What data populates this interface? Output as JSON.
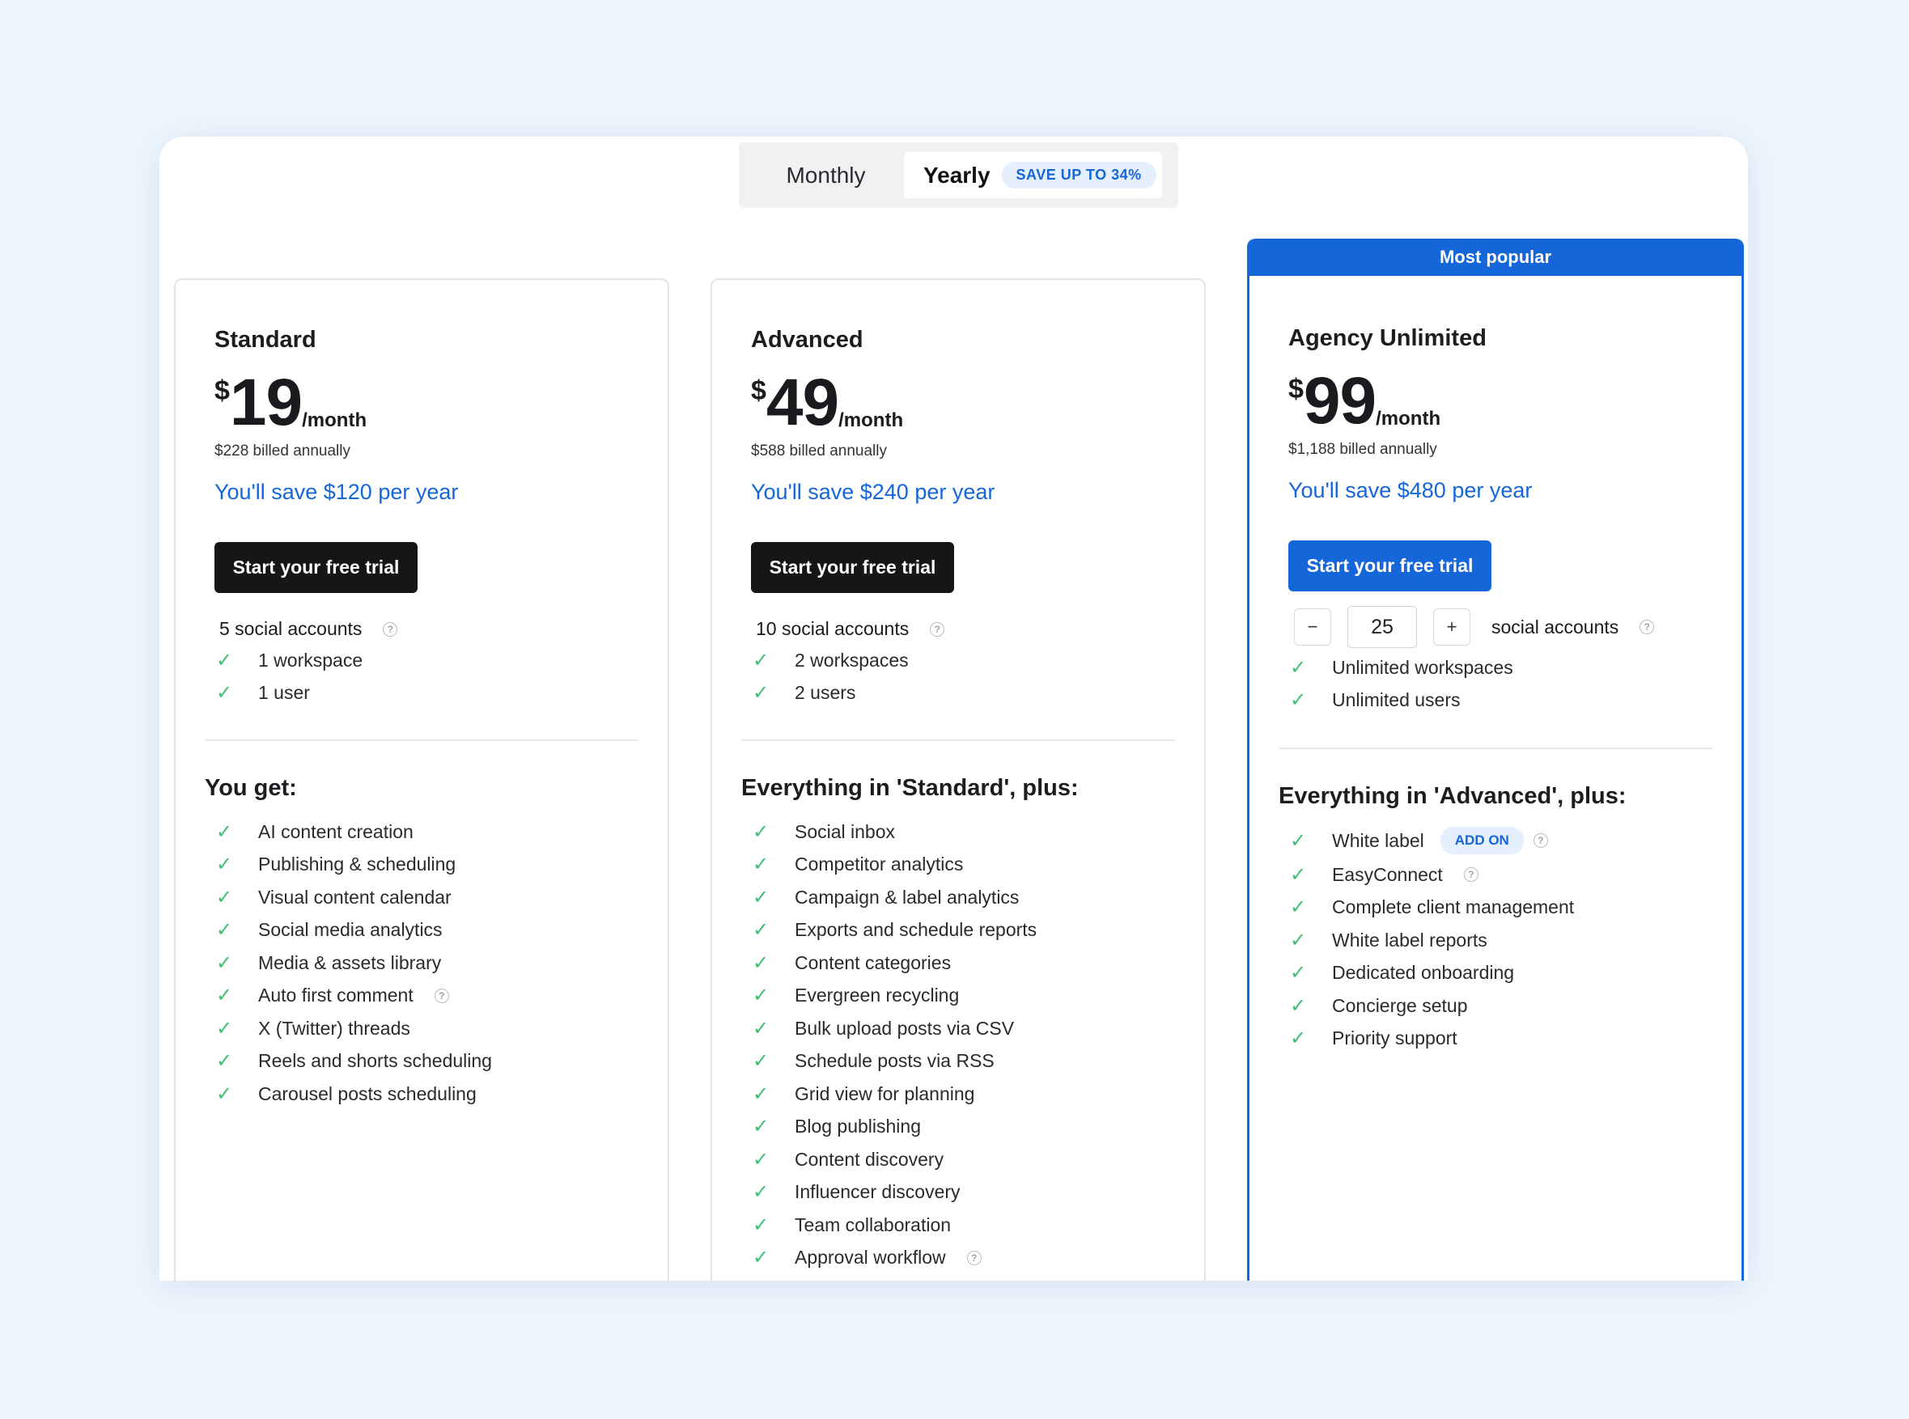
{
  "toggle": {
    "monthly": "Monthly",
    "yearly": "Yearly",
    "badge": "SAVE UP TO 34%"
  },
  "plans": [
    {
      "name": "Standard",
      "currency": "$",
      "price": "19",
      "per": "/month",
      "billed": "$228 billed annually",
      "save": "You'll save $120 per year",
      "cta": "Start your free trial",
      "accounts": "5 social accounts",
      "basics": [
        "1 workspace",
        "1 user"
      ],
      "heading": "You get:",
      "features": [
        "AI content creation",
        "Publishing & scheduling",
        "Visual content calendar",
        "Social media analytics",
        "Media & assets library",
        "Auto first comment",
        "X (Twitter) threads",
        "Reels and shorts scheduling",
        "Carousel posts scheduling"
      ]
    },
    {
      "name": "Advanced",
      "currency": "$",
      "price": "49",
      "per": "/month",
      "billed": "$588 billed annually",
      "save": "You'll save $240 per year",
      "cta": "Start your free trial",
      "accounts": "10 social accounts",
      "basics": [
        "2 workspaces",
        "2 users"
      ],
      "heading": "Everything in 'Standard', plus:",
      "features": [
        "Social inbox",
        "Competitor analytics",
        "Campaign & label analytics",
        "Exports and schedule reports",
        "Content categories",
        "Evergreen recycling",
        "Bulk upload posts via CSV",
        "Schedule posts via RSS",
        "Grid view for planning",
        "Blog publishing",
        "Content discovery",
        "Influencer discovery",
        "Team collaboration",
        "Approval workflow"
      ]
    },
    {
      "name": "Agency Unlimited",
      "badge": "Most popular",
      "currency": "$",
      "price": "99",
      "per": "/month",
      "billed": "$1,188 billed annually",
      "save": "You'll save $480 per year",
      "cta": "Start your free trial",
      "stepper": {
        "minus": "−",
        "value": "25",
        "plus": "+",
        "label": "social accounts"
      },
      "basics": [
        "Unlimited workspaces",
        "Unlimited users"
      ],
      "heading": "Everything in 'Advanced', plus:",
      "addon": "ADD ON",
      "features": [
        "White label",
        "EasyConnect",
        "Complete client management",
        "White label reports",
        "Dedicated onboarding",
        "Concierge setup",
        "Priority support"
      ]
    }
  ],
  "colors": {
    "accent": "#1466d9",
    "check": "#3fbf74",
    "dark_button": "#161617"
  },
  "icons": {
    "check": "check-icon",
    "info": "info-icon"
  }
}
